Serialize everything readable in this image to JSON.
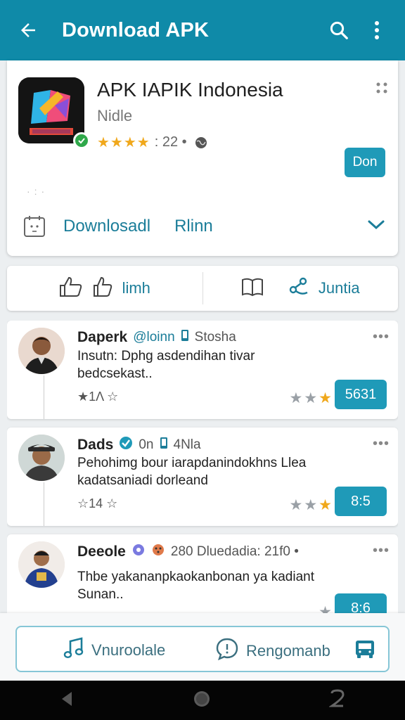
{
  "app_bar": {
    "title": "Download APK",
    "background": "#0f8aa8"
  },
  "app": {
    "name": "APK IAPIK Indonesia",
    "developer": "Nidle",
    "stars_label": "★★★★",
    "rating_count": ": 22 •",
    "open_button": "Don",
    "download_label": "Downlosadl",
    "rlinn_label": "Rlinn"
  },
  "actions": {
    "left_label": "limh",
    "right_label": "Juntia"
  },
  "reviews": [
    {
      "name": "Daperk",
      "meta1": "@loinn",
      "meta2": "Stosha",
      "text": "Insutn: Dphg asdendihan tivar bedcsekast..",
      "likes": "★1Λ ☆",
      "stars": 3,
      "score": "5631"
    },
    {
      "name": "Dads",
      "meta1": "0n",
      "meta2": "4Nla",
      "text": "Pehohimg bour iarapdanindokhns Llea kadatsaniadi dorleand",
      "likes": "☆14 ☆",
      "stars": 3,
      "score": "8:5"
    },
    {
      "name": "Deeole",
      "meta1": "",
      "meta2": "280 Dluedadia: 21f0 •",
      "text": "Thbe yakananpkaokanbonan ya kadiant Sunan..",
      "likes": "",
      "stars": 2,
      "score": "8:6"
    }
  ],
  "bottom_nav": {
    "item1": "Vnuroolale",
    "item2": "Rengomanb"
  },
  "colors": {
    "accent": "#1f9ab8",
    "star": "#f0a81c"
  }
}
